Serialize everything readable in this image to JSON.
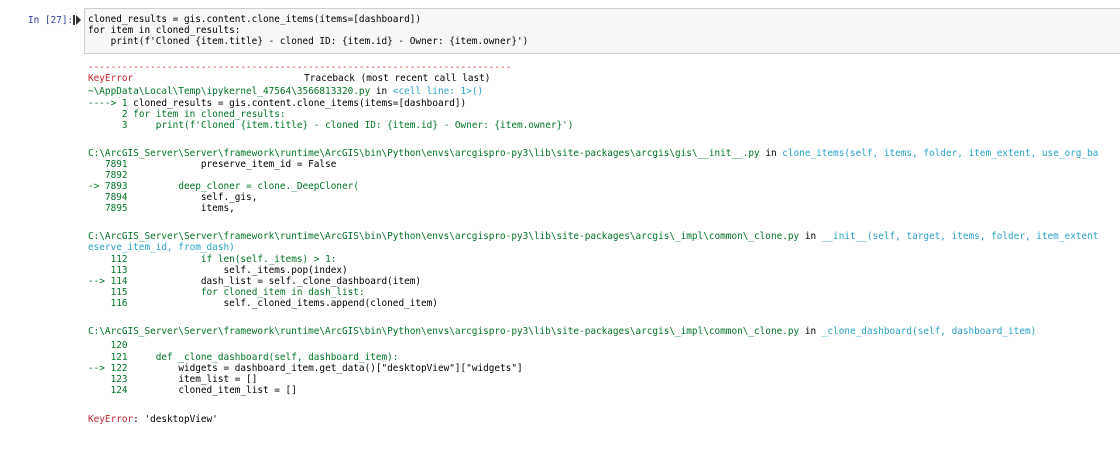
{
  "cell": {
    "prompt": "In [27]:",
    "code_lines": [
      "cloned_results = gis.content.clone_items(items=[dashboard])",
      "for item in cloned_results:",
      "    print(f'Cloned {item.title} - cloned ID: {item.id} - Owner: {item.owner}')"
    ]
  },
  "traceback": {
    "separator": "---------------------------------------------------------------------------",
    "error_name": "KeyError",
    "traceback_label": "Traceback (most recent call last)",
    "frame1": {
      "file": "~\\AppData\\Local\\Temp\\ipykernel_47564\\3566813320.py",
      "in_text": " in ",
      "location": "<cell line: 1>()",
      "lines": [
        {
          "marker": "----> ",
          "num": "1",
          "code": " cloned_results = gis.content.clone_items(items=[dashboard])"
        },
        {
          "marker": "      ",
          "num": "2",
          "code": " for item in cloned_results:"
        },
        {
          "marker": "      ",
          "num": "3",
          "code": "     print(f'Cloned {item.title} - cloned ID: {item.id} - Owner: {item.owner}')"
        }
      ]
    },
    "frame2": {
      "file": "C:\\ArcGIS_Server\\Server\\framework\\runtime\\ArcGIS\\bin\\Python\\envs\\arcgispro-py3\\lib\\site-packages\\arcgis\\gis\\__init__.py",
      "in_text": " in ",
      "location": "clone_items(self, items, folder, item_extent, use_org_ba",
      "lines": [
        {
          "marker": "   ",
          "num": "7891",
          "code": "             preserve_item_id = False"
        },
        {
          "marker": "   ",
          "num": "7892",
          "code": ""
        },
        {
          "marker": "-> ",
          "num": "7893",
          "code": "         deep_cloner = clone._DeepCloner("
        },
        {
          "marker": "   ",
          "num": "7894",
          "code": "             self._gis,"
        },
        {
          "marker": "   ",
          "num": "7895",
          "code": "             items,"
        }
      ]
    },
    "frame3": {
      "file": "C:\\ArcGIS_Server\\Server\\framework\\runtime\\ArcGIS\\bin\\Python\\envs\\arcgispro-py3\\lib\\site-packages\\arcgis\\_impl\\common\\_clone.py",
      "in_text": " in ",
      "location": "__init__(self, target, items, folder, item_extent",
      "location_cont": "eserve_item_id, from_dash)",
      "lines": [
        {
          "marker": "    ",
          "num": "112",
          "code": "             if len(self._items) > 1:"
        },
        {
          "marker": "    ",
          "num": "113",
          "code": "                 self._items.pop(index)"
        },
        {
          "marker": "--> ",
          "num": "114",
          "code": "             dash_list = self._clone_dashboard(item)"
        },
        {
          "marker": "    ",
          "num": "115",
          "code": "             for cloned_item in dash_list:"
        },
        {
          "marker": "    ",
          "num": "116",
          "code": "                 self._cloned_items.append(cloned_item)"
        }
      ]
    },
    "frame4": {
      "file": "C:\\ArcGIS_Server\\Server\\framework\\runtime\\ArcGIS\\bin\\Python\\envs\\arcgispro-py3\\lib\\site-packages\\arcgis\\_impl\\common\\_clone.py",
      "in_text": " in ",
      "location": "_clone_dashboard(self, dashboard_item)",
      "lines": [
        {
          "marker": "    ",
          "num": "120",
          "code": ""
        },
        {
          "marker": "    ",
          "num": "121",
          "code": "     def _clone_dashboard(self, dashboard_item):"
        },
        {
          "marker": "--> ",
          "num": "122",
          "code": "         widgets = dashboard_item.get_data()[\"desktopView\"][\"widgets\"]"
        },
        {
          "marker": "    ",
          "num": "123",
          "code": "         item_list = []"
        },
        {
          "marker": "    ",
          "num": "124",
          "code": "         cloned_item_list = []"
        }
      ]
    },
    "final_error_name": "KeyError",
    "final_error_msg": ": 'desktopView'"
  }
}
